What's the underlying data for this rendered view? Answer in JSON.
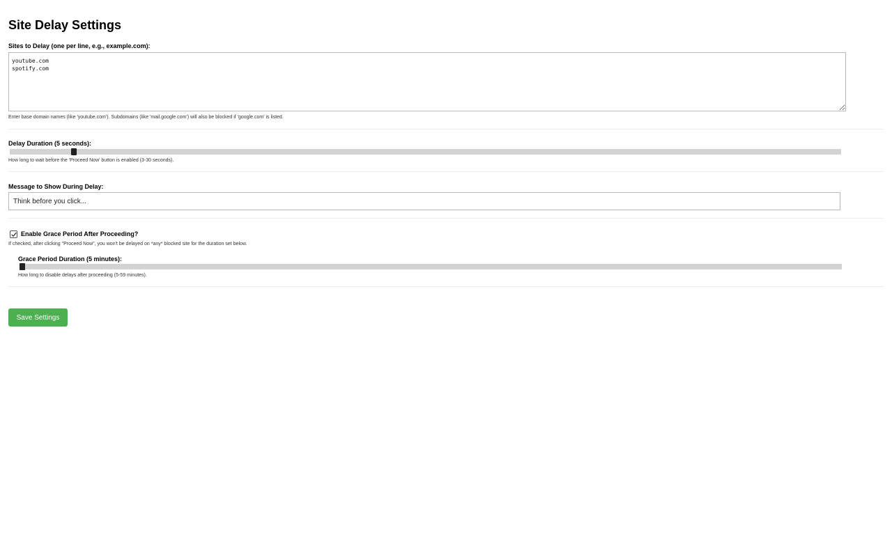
{
  "page_title": "Site Delay Settings",
  "sites": {
    "label": "Sites to Delay (one per line, e.g., example.com):",
    "value": "youtube.com\nspotify.com",
    "help": "Enter base domain names (like 'youtube.com'). Subdomains (like 'mail.google.com') will also be blocked if 'google.com' is listed."
  },
  "delay": {
    "label": "Delay Duration (5 seconds):",
    "value": 5,
    "min": 3,
    "max": 30,
    "help": "How long to wait before the 'Proceed Now' button is enabled (3-30 seconds)."
  },
  "message": {
    "label": "Message to Show During Delay:",
    "value": "Think before you click..."
  },
  "grace": {
    "checkbox_label": "Enable Grace Period After Proceeding?",
    "checked": true,
    "help": "If checked, after clicking \"Proceed Now\", you won't be delayed on *any* blocked site for the duration set below.",
    "duration_label": "Grace Period Duration (5 minutes):",
    "duration_value": 5,
    "duration_min": 5,
    "duration_max": 59,
    "duration_help": "How long to disable delays after proceeding (5-59 minutes)."
  },
  "save_label": "Save Settings",
  "colors": {
    "save_button": "#4caf50",
    "slider_track": "#d3d3d3",
    "slider_thumb": "#222222"
  }
}
